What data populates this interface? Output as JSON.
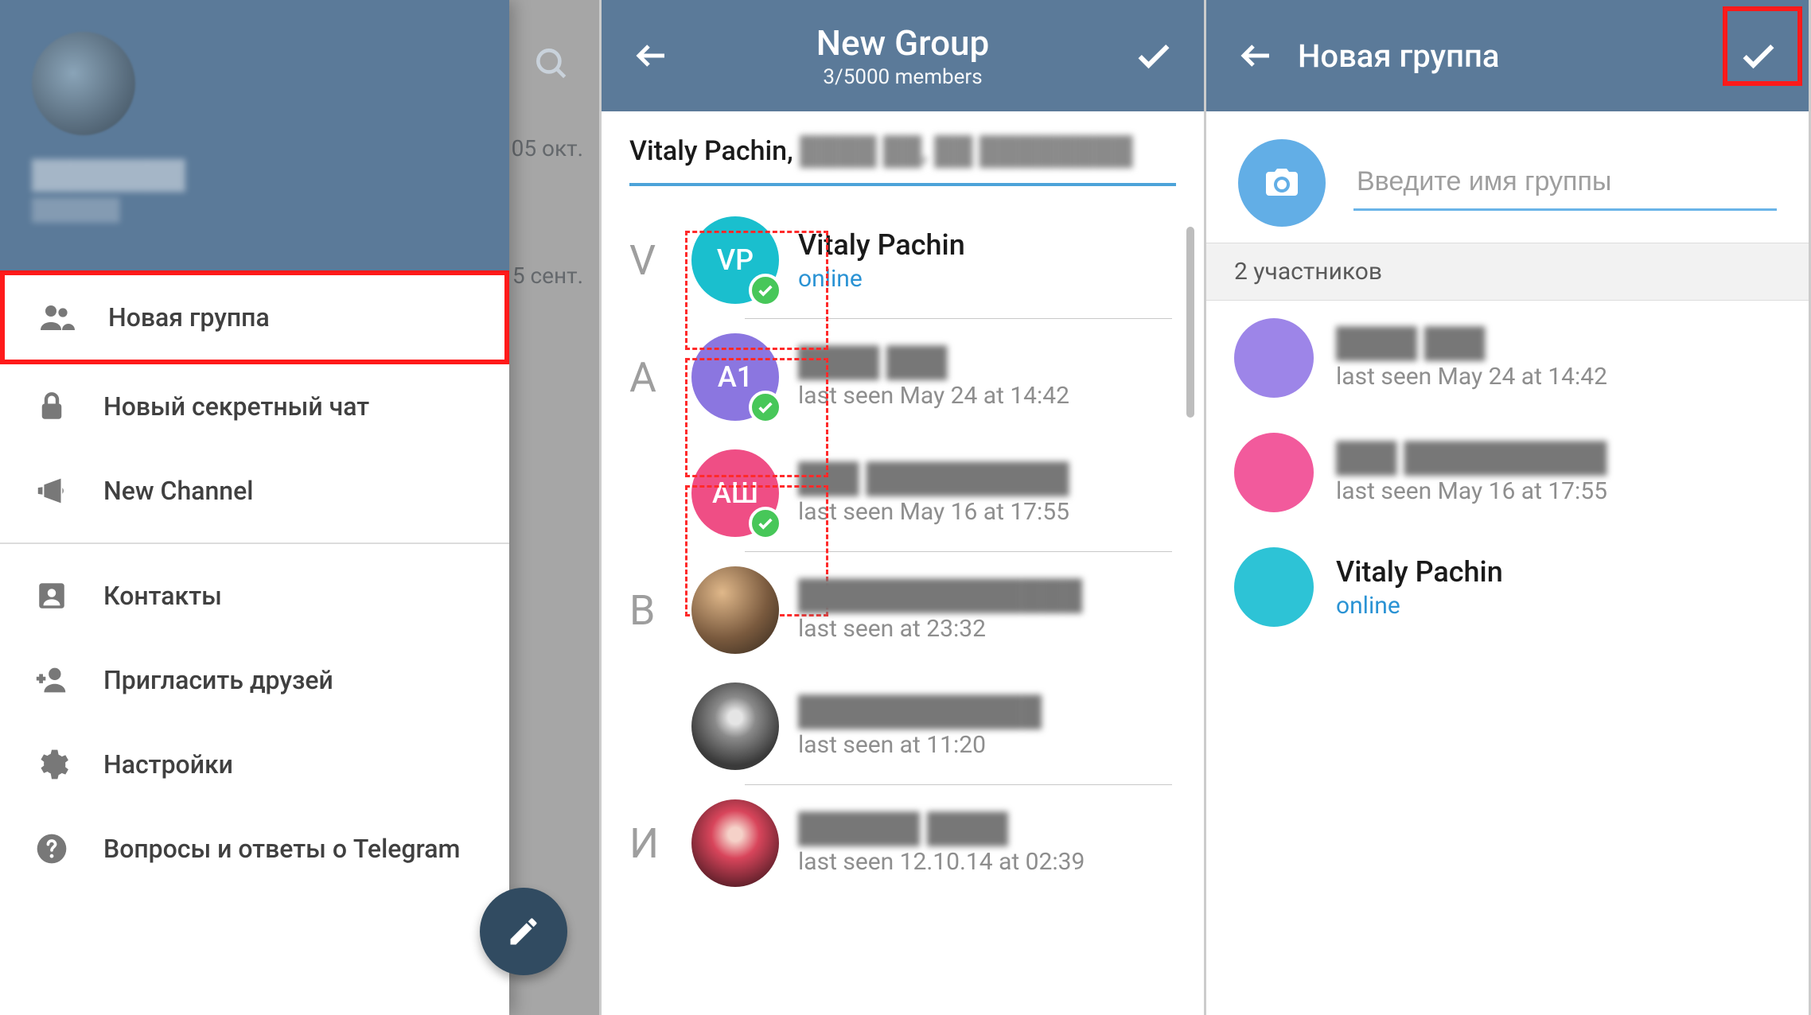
{
  "screen1": {
    "bg_dates": [
      "05 окт.",
      "5 сент."
    ],
    "menu": {
      "new_group": "Новая группа",
      "new_secret_chat": "Новый секретный чат",
      "new_channel": "New Channel",
      "contacts": "Контакты",
      "invite": "Пригласить друзей",
      "settings": "Настройки",
      "faq": "Вопросы и ответы о Telegram"
    }
  },
  "screen2": {
    "title": "New Group",
    "subtitle": "3/5000 members",
    "selected_first": "Vitaly Pachin, ",
    "sections": {
      "V": [
        {
          "initials": "VP",
          "name": "Vitaly Pachin",
          "status": "online",
          "online": true,
          "selected": true,
          "blurred": false
        }
      ],
      "A": [
        {
          "initials": "A1",
          "name": "——",
          "status": "last seen May 24 at 14:42",
          "online": false,
          "selected": true,
          "blurred": true
        },
        {
          "initials": "АШ",
          "name": "——",
          "status": "last seen May 16 at 17:55",
          "online": false,
          "selected": true,
          "blurred": true
        }
      ],
      "B": [
        {
          "name": "——",
          "status": "last seen at 23:32",
          "blurred": true
        },
        {
          "name": "——",
          "status": "last seen at 11:20",
          "blurred": true
        }
      ],
      "I": [
        {
          "name": "——",
          "status": "last seen 12.10.14 at 02:39",
          "blurred": true
        }
      ]
    },
    "letters": {
      "V": "V",
      "A": "A",
      "B": "В",
      "I": "И"
    }
  },
  "screen3": {
    "title": "Новая группа",
    "placeholder": "Введите имя группы",
    "members_hdr": "2 участников",
    "members": [
      {
        "name": "——",
        "status": "last seen May 24 at 14:42",
        "blurred": true
      },
      {
        "name": "——",
        "status": "last seen May 16 at 17:55",
        "blurred": true
      },
      {
        "name": "Vitaly Pachin",
        "status": "online",
        "online": true,
        "blurred": false
      }
    ]
  }
}
